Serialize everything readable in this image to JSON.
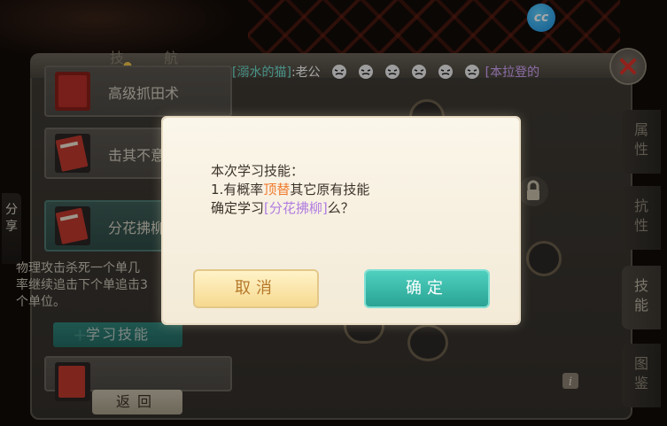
{
  "overlay": {
    "cc_badge": "cc",
    "chat": {
      "name": "[溺水的猫]",
      "text": ":老公",
      "tail": "[本拉登的"
    },
    "panel_title": "技 航"
  },
  "left_list": {
    "items": [
      {
        "label": "高级抓田术"
      },
      {
        "label": "击其不意"
      },
      {
        "label": "分花拂柳"
      }
    ],
    "selected_description": "物理攻击杀死一个单几率继续追击下个单追击3个单位。",
    "learn_button": "学习技能",
    "back_button": "返回"
  },
  "right_tabs": [
    {
      "label": "属性"
    },
    {
      "label": "抗性"
    },
    {
      "label": "技能"
    },
    {
      "label": "图鉴"
    }
  ],
  "share_tab": "分享",
  "dialog": {
    "line1": "本次学习技能：",
    "line2_prefix": "1.有概率",
    "line2_highlight": "顶替",
    "line2_suffix": "其它原有技能",
    "line3_prefix": "确定学习",
    "line3_highlight": "[分花拂柳]",
    "line3_suffix": "么？",
    "cancel_label": "取消",
    "confirm_label": "确定"
  },
  "colors": {
    "accent_teal": "#2aa394",
    "highlight_orange": "#f07a2e",
    "highlight_purple": "#b07ce0",
    "chat_name": "#6fe0d0"
  }
}
